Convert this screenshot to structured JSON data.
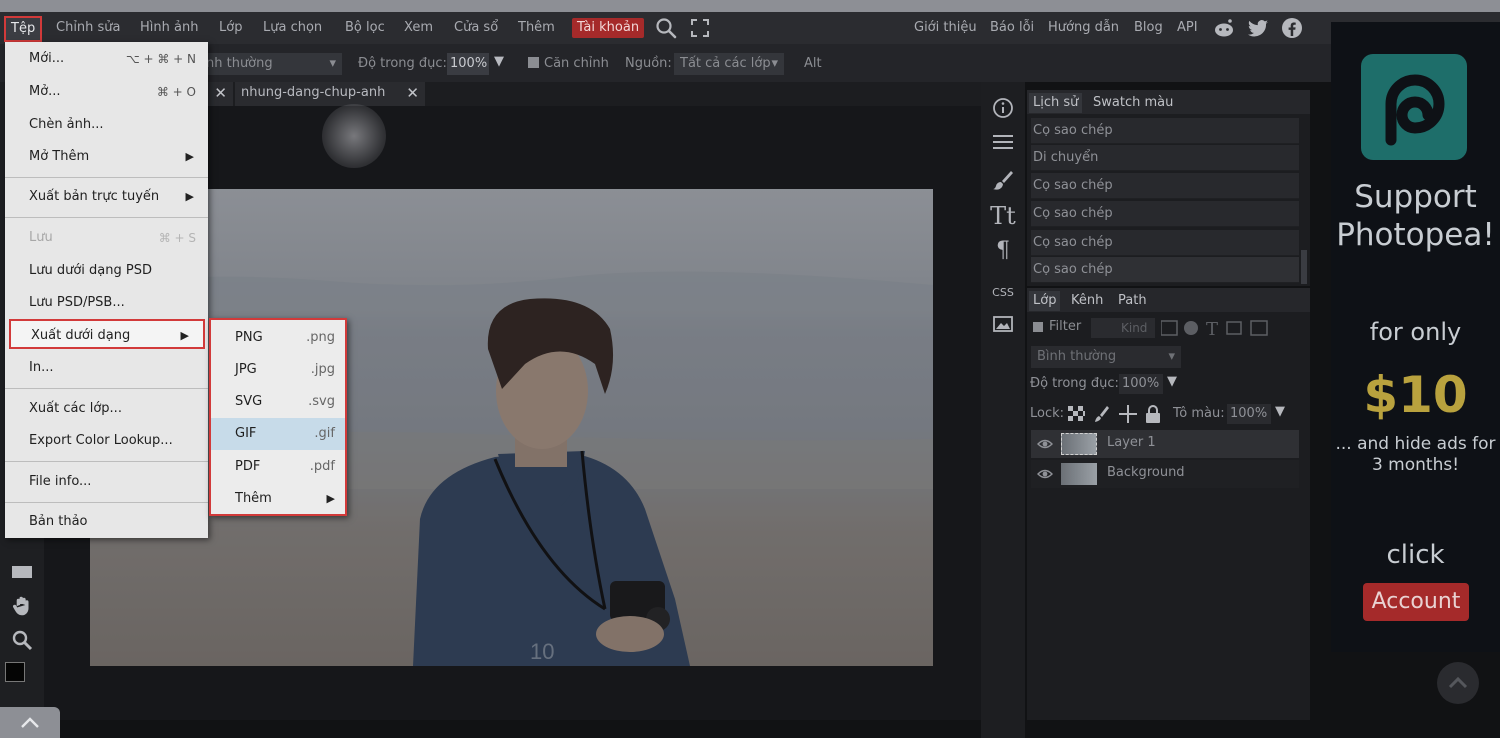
{
  "menubar": {
    "items": [
      "Tệp",
      "Chỉnh sửa",
      "Hình ảnh",
      "Lớp",
      "Lựa chọn",
      "Bộ lọc",
      "Xem",
      "Cửa sổ",
      "Thêm"
    ],
    "account": "Tài khoản",
    "right_links": [
      "Giới thiệu",
      "Báo lỗi",
      "Hướng dẫn",
      "Blog",
      "API"
    ]
  },
  "options": {
    "blend_mode": "nh thường",
    "opacity_label": "Độ trong đục:",
    "opacity_value": "100%",
    "align_label": "Căn chỉnh",
    "source_label": "Nguồn:",
    "source_value": "Tất cả các lớp",
    "alt_label": "Alt"
  },
  "tabs": [
    "nhung-dang-chup-anh"
  ],
  "file_menu": {
    "items": [
      {
        "label": "Mới...",
        "shortcut": "⌥ + ⌘ + N"
      },
      {
        "label": "Mở...",
        "shortcut": "⌘ + O"
      },
      {
        "label": "Chèn ảnh..."
      },
      {
        "label": "Mở Thêm"
      },
      {
        "label": "Xuất bản trực tuyến"
      },
      {
        "label": "Lưu",
        "shortcut": "⌘ + S"
      },
      {
        "label": "Lưu dưới dạng PSD"
      },
      {
        "label": "Lưu PSD/PSB..."
      },
      {
        "label": "Xuất dưới dạng"
      },
      {
        "label": "In..."
      },
      {
        "label": "Xuất các lớp..."
      },
      {
        "label": "Export Color Lookup..."
      },
      {
        "label": "File info..."
      },
      {
        "label": "Bản thảo"
      }
    ]
  },
  "export_submenu": {
    "items": [
      {
        "label": "PNG",
        "ext": ".png"
      },
      {
        "label": "JPG",
        "ext": ".jpg"
      },
      {
        "label": "SVG",
        "ext": ".svg"
      },
      {
        "label": "GIF",
        "ext": ".gif"
      },
      {
        "label": "PDF",
        "ext": ".pdf"
      },
      {
        "label": "Thêm"
      }
    ]
  },
  "iconstrip": {
    "css_label": "CSS"
  },
  "history_panel": {
    "tabs": [
      "Lịch sử",
      "Swatch màu"
    ],
    "items": [
      "Cọ sao chép",
      "Di chuyển",
      "Cọ sao chép",
      "Cọ sao chép",
      "Cọ sao chép",
      "Cọ sao chép"
    ]
  },
  "layers_panel": {
    "tabs": [
      "Lớp",
      "Kênh",
      "Path"
    ],
    "filter_label": "Filter",
    "filter_kind": "Kind",
    "blend_mode": "Bình thường",
    "opacity_label": "Độ trong đục:",
    "opacity_value": "100%",
    "lock_label": "Lock:",
    "fill_label": "Tô màu:",
    "fill_value": "100%",
    "layers": [
      "Layer 1",
      "Background"
    ]
  },
  "ad": {
    "line1": "Support Photopea!",
    "line2": "for only",
    "price": "$10",
    "line3": "... and hide ads for 3 months!",
    "click": "click",
    "account_button": "Account",
    "brand_color": "#1e6e6a",
    "price_color": "#b9a23e"
  }
}
